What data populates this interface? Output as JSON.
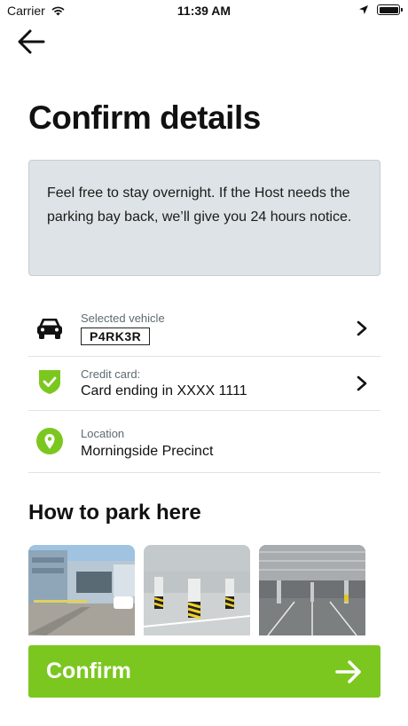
{
  "status_bar": {
    "carrier": "Carrier",
    "time": "11:39 AM",
    "icons": [
      "wifi-icon",
      "location-arrow-icon",
      "battery-icon"
    ]
  },
  "header": {
    "back_icon": "arrow-left-icon",
    "title": "Confirm details"
  },
  "notice": {
    "text": "Feel free to stay overnight. If the Host needs the parking bay back, we’ll give you 24 hours notice."
  },
  "details": {
    "vehicle": {
      "label": "Selected vehicle",
      "plate": "P4RK3R",
      "icon": "car-icon"
    },
    "payment": {
      "label": "Credit card:",
      "value": "Card ending in XXXX 1111",
      "icon": "shield-check-icon"
    },
    "location": {
      "label": "Location",
      "value": "Morningside Precinct",
      "icon": "map-pin-icon"
    }
  },
  "how_to_park": {
    "title": "How to park here",
    "photos": [
      "building-entrance-photo",
      "parking-garage-photo",
      "underground-carpark-photo"
    ]
  },
  "confirm": {
    "label": "Confirm",
    "icon": "arrow-right-icon"
  },
  "colors": {
    "accent": "#7bc71f",
    "notice_bg": "#dde3e6",
    "label": "#5c6b72"
  }
}
